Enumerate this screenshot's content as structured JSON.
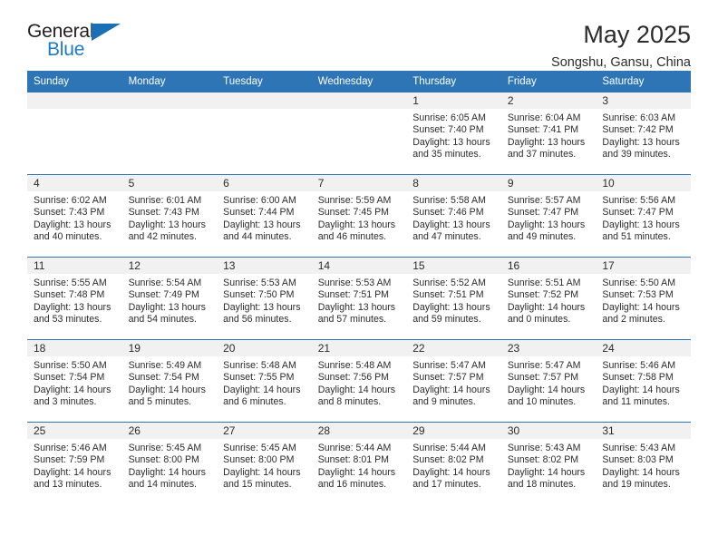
{
  "logo": {
    "word_top": "General",
    "word_bottom": "Blue",
    "triangle_color": "#1b6fb5",
    "text_color": "#231f20",
    "blue_color": "#1f7bc1"
  },
  "header": {
    "title": "May 2025",
    "subtitle": "Songshu, Gansu, China"
  },
  "theme": {
    "header_bg": "#2e75b6",
    "header_text": "#ffffff",
    "daynum_band_bg": "#f1f1f1",
    "cell_bg": "#ffffff",
    "text": "#2b2b2b"
  },
  "weekday_headers": [
    "Sunday",
    "Monday",
    "Tuesday",
    "Wednesday",
    "Thursday",
    "Friday",
    "Saturday"
  ],
  "labels": {
    "sunrise": "Sunrise:",
    "sunset": "Sunset:",
    "daylight": "Daylight:"
  },
  "weeks": [
    [
      {
        "day": "",
        "empty": true
      },
      {
        "day": "",
        "empty": true
      },
      {
        "day": "",
        "empty": true
      },
      {
        "day": "",
        "empty": true
      },
      {
        "day": "1",
        "sunrise": "Sunrise: 6:05 AM",
        "sunset": "Sunset: 7:40 PM",
        "daylight": "Daylight: 13 hours and 35 minutes."
      },
      {
        "day": "2",
        "sunrise": "Sunrise: 6:04 AM",
        "sunset": "Sunset: 7:41 PM",
        "daylight": "Daylight: 13 hours and 37 minutes."
      },
      {
        "day": "3",
        "sunrise": "Sunrise: 6:03 AM",
        "sunset": "Sunset: 7:42 PM",
        "daylight": "Daylight: 13 hours and 39 minutes."
      }
    ],
    [
      {
        "day": "4",
        "sunrise": "Sunrise: 6:02 AM",
        "sunset": "Sunset: 7:43 PM",
        "daylight": "Daylight: 13 hours and 40 minutes."
      },
      {
        "day": "5",
        "sunrise": "Sunrise: 6:01 AM",
        "sunset": "Sunset: 7:43 PM",
        "daylight": "Daylight: 13 hours and 42 minutes."
      },
      {
        "day": "6",
        "sunrise": "Sunrise: 6:00 AM",
        "sunset": "Sunset: 7:44 PM",
        "daylight": "Daylight: 13 hours and 44 minutes."
      },
      {
        "day": "7",
        "sunrise": "Sunrise: 5:59 AM",
        "sunset": "Sunset: 7:45 PM",
        "daylight": "Daylight: 13 hours and 46 minutes."
      },
      {
        "day": "8",
        "sunrise": "Sunrise: 5:58 AM",
        "sunset": "Sunset: 7:46 PM",
        "daylight": "Daylight: 13 hours and 47 minutes."
      },
      {
        "day": "9",
        "sunrise": "Sunrise: 5:57 AM",
        "sunset": "Sunset: 7:47 PM",
        "daylight": "Daylight: 13 hours and 49 minutes."
      },
      {
        "day": "10",
        "sunrise": "Sunrise: 5:56 AM",
        "sunset": "Sunset: 7:47 PM",
        "daylight": "Daylight: 13 hours and 51 minutes."
      }
    ],
    [
      {
        "day": "11",
        "sunrise": "Sunrise: 5:55 AM",
        "sunset": "Sunset: 7:48 PM",
        "daylight": "Daylight: 13 hours and 53 minutes."
      },
      {
        "day": "12",
        "sunrise": "Sunrise: 5:54 AM",
        "sunset": "Sunset: 7:49 PM",
        "daylight": "Daylight: 13 hours and 54 minutes."
      },
      {
        "day": "13",
        "sunrise": "Sunrise: 5:53 AM",
        "sunset": "Sunset: 7:50 PM",
        "daylight": "Daylight: 13 hours and 56 minutes."
      },
      {
        "day": "14",
        "sunrise": "Sunrise: 5:53 AM",
        "sunset": "Sunset: 7:51 PM",
        "daylight": "Daylight: 13 hours and 57 minutes."
      },
      {
        "day": "15",
        "sunrise": "Sunrise: 5:52 AM",
        "sunset": "Sunset: 7:51 PM",
        "daylight": "Daylight: 13 hours and 59 minutes."
      },
      {
        "day": "16",
        "sunrise": "Sunrise: 5:51 AM",
        "sunset": "Sunset: 7:52 PM",
        "daylight": "Daylight: 14 hours and 0 minutes."
      },
      {
        "day": "17",
        "sunrise": "Sunrise: 5:50 AM",
        "sunset": "Sunset: 7:53 PM",
        "daylight": "Daylight: 14 hours and 2 minutes."
      }
    ],
    [
      {
        "day": "18",
        "sunrise": "Sunrise: 5:50 AM",
        "sunset": "Sunset: 7:54 PM",
        "daylight": "Daylight: 14 hours and 3 minutes."
      },
      {
        "day": "19",
        "sunrise": "Sunrise: 5:49 AM",
        "sunset": "Sunset: 7:54 PM",
        "daylight": "Daylight: 14 hours and 5 minutes."
      },
      {
        "day": "20",
        "sunrise": "Sunrise: 5:48 AM",
        "sunset": "Sunset: 7:55 PM",
        "daylight": "Daylight: 14 hours and 6 minutes."
      },
      {
        "day": "21",
        "sunrise": "Sunrise: 5:48 AM",
        "sunset": "Sunset: 7:56 PM",
        "daylight": "Daylight: 14 hours and 8 minutes."
      },
      {
        "day": "22",
        "sunrise": "Sunrise: 5:47 AM",
        "sunset": "Sunset: 7:57 PM",
        "daylight": "Daylight: 14 hours and 9 minutes."
      },
      {
        "day": "23",
        "sunrise": "Sunrise: 5:47 AM",
        "sunset": "Sunset: 7:57 PM",
        "daylight": "Daylight: 14 hours and 10 minutes."
      },
      {
        "day": "24",
        "sunrise": "Sunrise: 5:46 AM",
        "sunset": "Sunset: 7:58 PM",
        "daylight": "Daylight: 14 hours and 11 minutes."
      }
    ],
    [
      {
        "day": "25",
        "sunrise": "Sunrise: 5:46 AM",
        "sunset": "Sunset: 7:59 PM",
        "daylight": "Daylight: 14 hours and 13 minutes."
      },
      {
        "day": "26",
        "sunrise": "Sunrise: 5:45 AM",
        "sunset": "Sunset: 8:00 PM",
        "daylight": "Daylight: 14 hours and 14 minutes."
      },
      {
        "day": "27",
        "sunrise": "Sunrise: 5:45 AM",
        "sunset": "Sunset: 8:00 PM",
        "daylight": "Daylight: 14 hours and 15 minutes."
      },
      {
        "day": "28",
        "sunrise": "Sunrise: 5:44 AM",
        "sunset": "Sunset: 8:01 PM",
        "daylight": "Daylight: 14 hours and 16 minutes."
      },
      {
        "day": "29",
        "sunrise": "Sunrise: 5:44 AM",
        "sunset": "Sunset: 8:02 PM",
        "daylight": "Daylight: 14 hours and 17 minutes."
      },
      {
        "day": "30",
        "sunrise": "Sunrise: 5:43 AM",
        "sunset": "Sunset: 8:02 PM",
        "daylight": "Daylight: 14 hours and 18 minutes."
      },
      {
        "day": "31",
        "sunrise": "Sunrise: 5:43 AM",
        "sunset": "Sunset: 8:03 PM",
        "daylight": "Daylight: 14 hours and 19 minutes."
      }
    ]
  ]
}
